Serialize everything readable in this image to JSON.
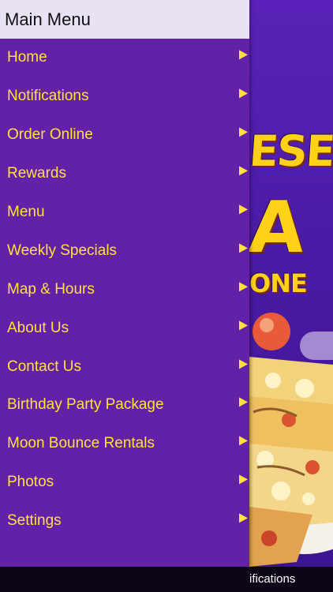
{
  "drawer": {
    "title": "Main Menu",
    "items": [
      {
        "label": "Home"
      },
      {
        "label": "Notifications"
      },
      {
        "label": "Order Online"
      },
      {
        "label": "Rewards"
      },
      {
        "label": "Menu"
      },
      {
        "label": "Weekly Specials"
      },
      {
        "label": "Map & Hours"
      },
      {
        "label": "About Us"
      },
      {
        "label": "Contact Us"
      },
      {
        "label": "Birthday Party Package"
      },
      {
        "label": "Moon Bounce Rentals"
      },
      {
        "label": "Photos"
      },
      {
        "label": "Settings"
      }
    ]
  },
  "background": {
    "promo_line1": "ESE",
    "promo_line2": "A",
    "promo_line3": "ONE",
    "bottom_tab_label": "ifications"
  },
  "colors": {
    "drawer_bg": "#6221a7",
    "header_bg": "#e9e1f4",
    "menu_text": "#ffe23a"
  }
}
